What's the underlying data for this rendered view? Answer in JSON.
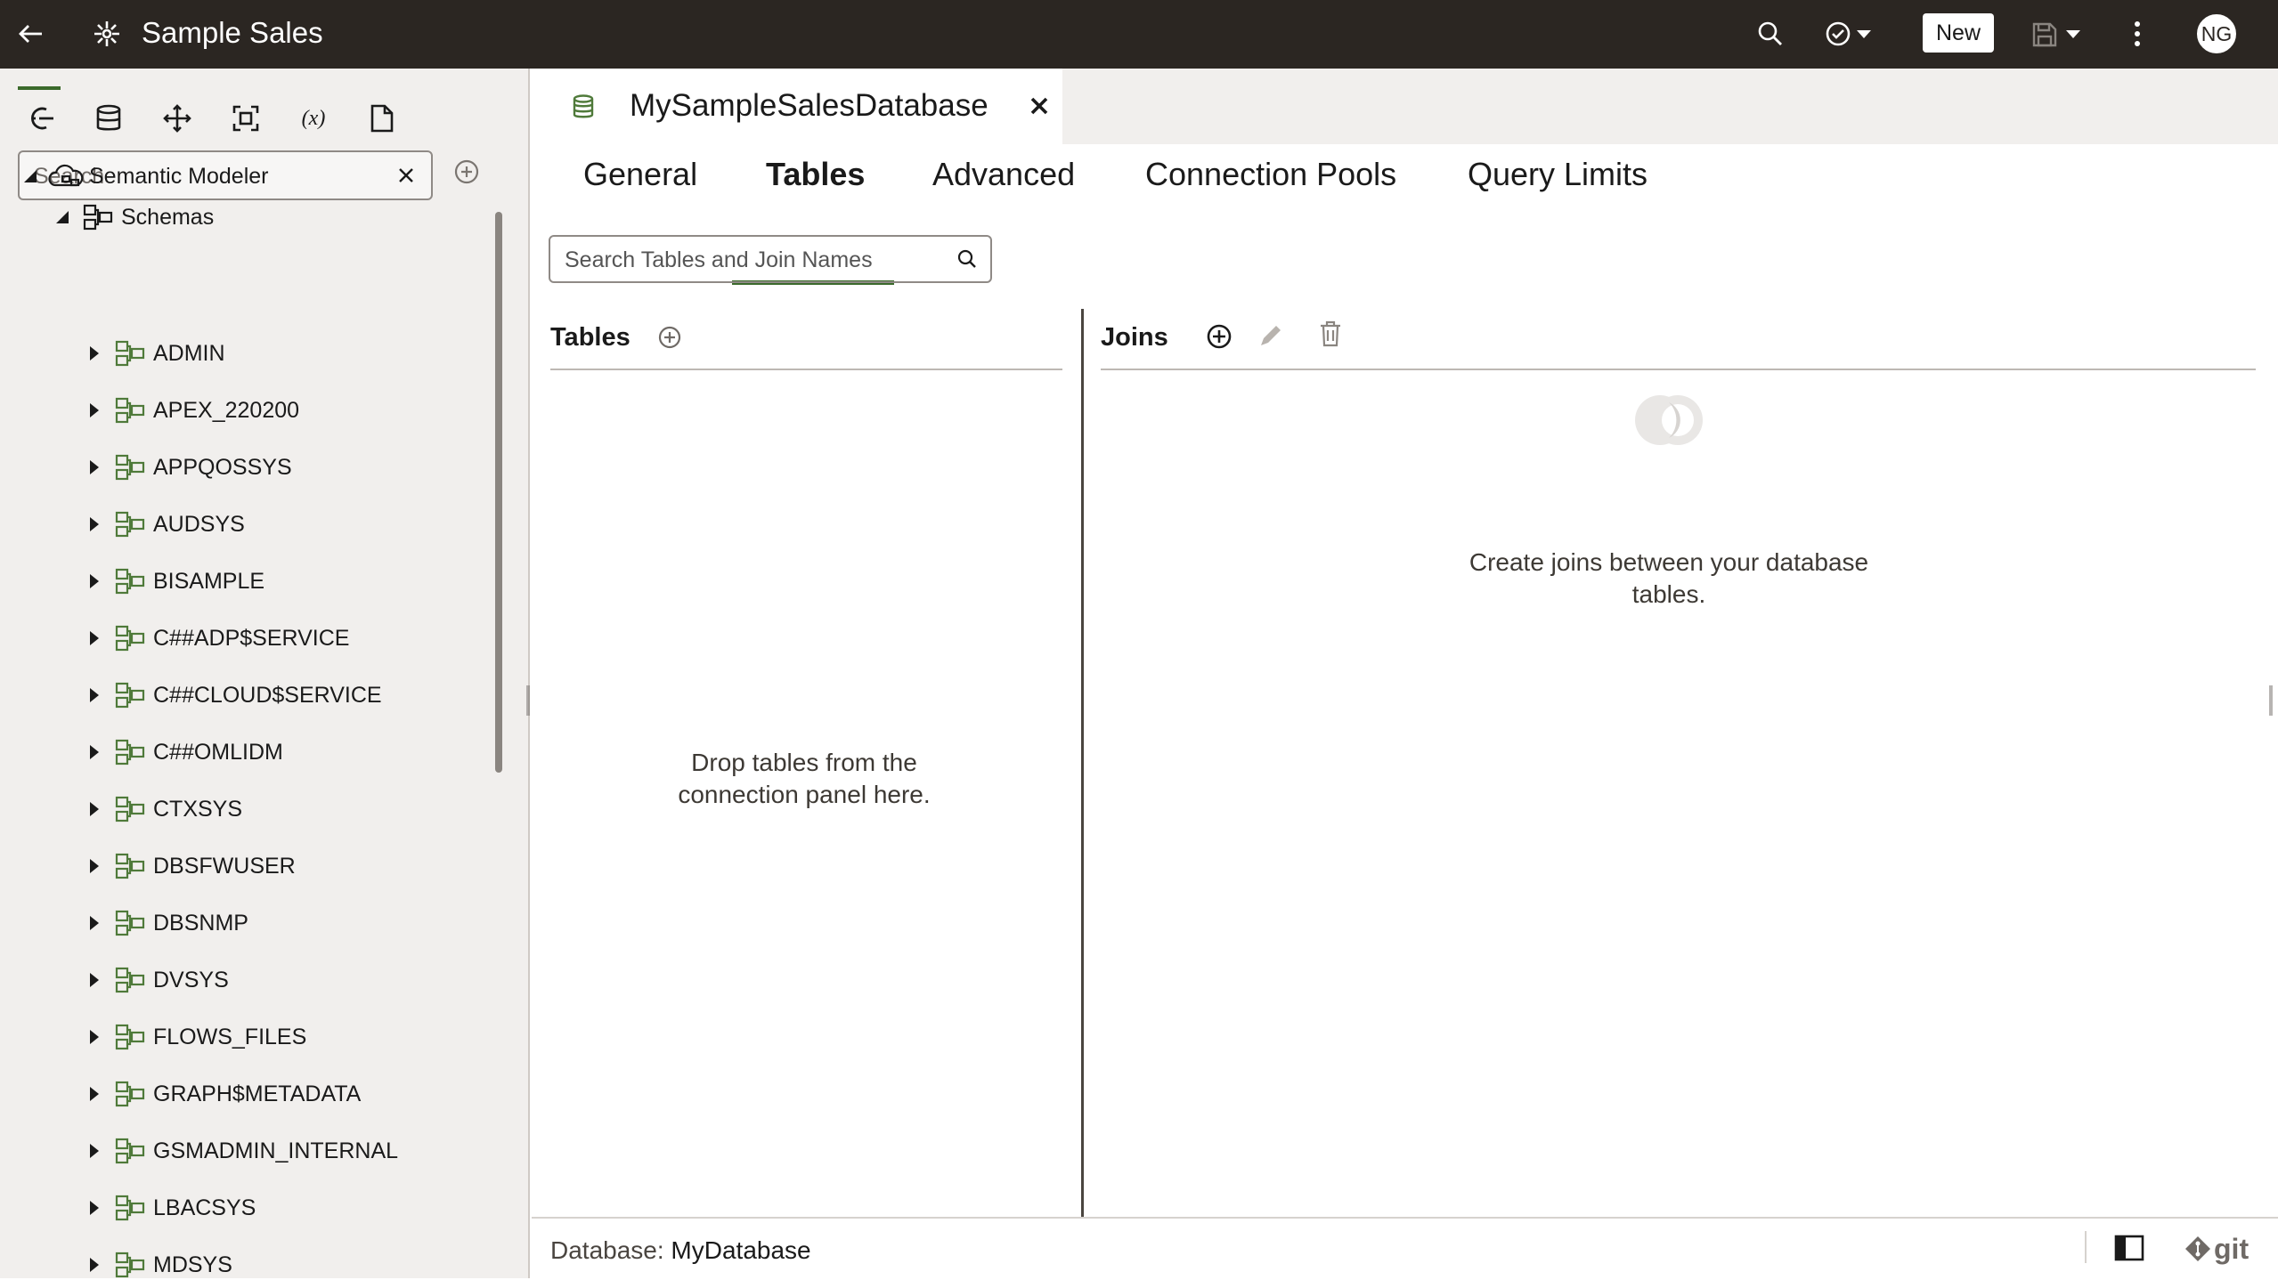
{
  "topbar": {
    "app_title": "Sample Sales",
    "new_label": "New",
    "avatar_initials": "NG"
  },
  "left_panel": {
    "search_placeholder": "Search",
    "tree": {
      "root_label": "Semantic Modeler",
      "schemas_label": "Schemas",
      "schemas": [
        "ADMIN",
        "APEX_220200",
        "APPQOSSYS",
        "AUDSYS",
        "BISAMPLE",
        "C##ADP$SERVICE",
        "C##CLOUD$SERVICE",
        "C##OMLIDM",
        "CTXSYS",
        "DBSFWUSER",
        "DBSNMP",
        "DVSYS",
        "FLOWS_FILES",
        "GRAPH$METADATA",
        "GSMADMIN_INTERNAL",
        "LBACSYS",
        "MDSYS"
      ]
    }
  },
  "editor": {
    "doc_tab_title": "MySampleSalesDatabase",
    "tabs": [
      "General",
      "Tables",
      "Advanced",
      "Connection Pools",
      "Query Limits"
    ],
    "active_tab": "Tables",
    "search_placeholder": "Search Tables and Join Names",
    "tables_title": "Tables",
    "joins_title": "Joins",
    "tables_empty": "Drop tables from the connection panel here.",
    "joins_empty": "Create joins between your database tables.",
    "status_db_label": "Database:",
    "status_db_value": "MyDatabase",
    "git_label": "git"
  },
  "colors": {
    "topbar_bg": "#2b2622",
    "accent": "#3b6a2b",
    "panel_bg": "#f1efed",
    "schema_icon": "#4f7a3a"
  }
}
